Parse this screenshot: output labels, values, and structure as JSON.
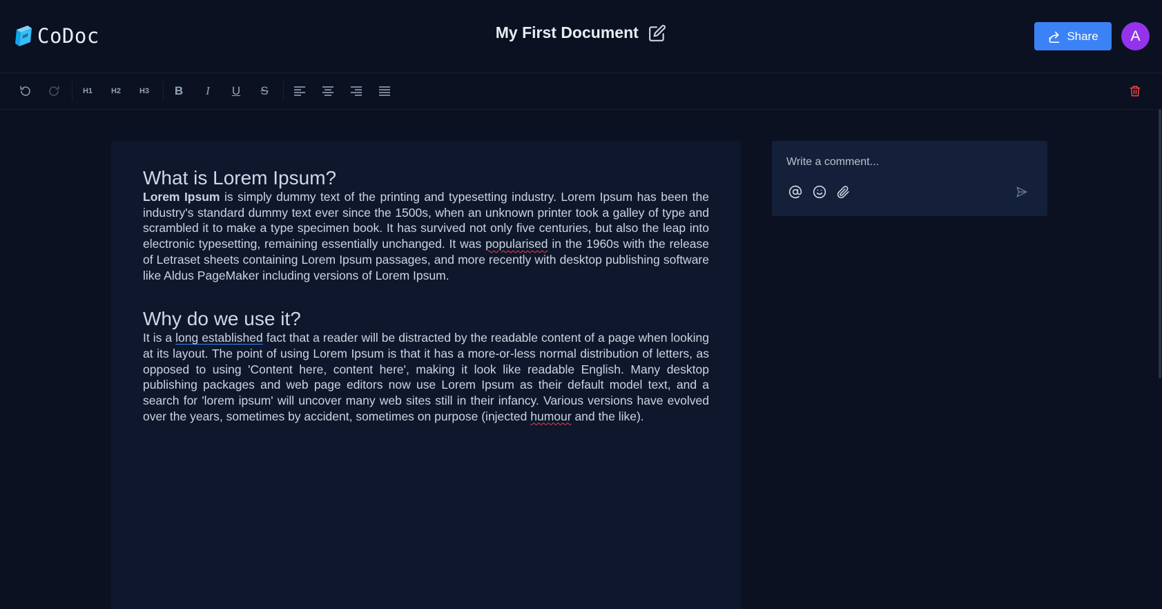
{
  "app": {
    "name": "CoDoc"
  },
  "document": {
    "title": "My First Document"
  },
  "header": {
    "share_label": "Share",
    "avatar_initial": "A"
  },
  "toolbar": {
    "undo_icon": "undo-icon",
    "redo_icon": "redo-icon",
    "h1_label": "H1",
    "h2_label": "H2",
    "h3_label": "H3",
    "bold_label": "B",
    "italic_label": "I",
    "underline_label": "U",
    "strike_label": "S",
    "delete_icon": "trash-icon",
    "delete_color": "#ef4444"
  },
  "content": {
    "section1": {
      "heading": "What is Lorem Ipsum?",
      "bold_lead": "Lorem Ipsum",
      "text_part1": " is simply dummy text of the printing and typesetting industry. Lorem Ipsum has been the industry's standard dummy text ever since the 1500s, when an unknown printer took a galley of type and scrambled it to make a type specimen book. It has survived not only five centuries, but also the leap into electronic typesetting, remaining essentially unchanged. It was ",
      "spell_word": "popularised",
      "text_part2": " in the 1960s with the release of Letraset sheets containing Lorem Ipsum passages, and more recently with desktop publishing software like Aldus PageMaker including versions of Lorem Ipsum."
    },
    "section2": {
      "heading": "Why do we use it?",
      "text_part1": "It is a ",
      "link_text": "long established",
      "text_part2": " fact that a reader will be distracted by the readable content of a page when looking at its layout. The point of using Lorem Ipsum is that it has a more-or-less normal distribution of letters, as opposed to using 'Content here, content here', making it look like readable English. Many desktop publishing packages and web page editors now use Lorem Ipsum as their default model text, and a search for 'lorem ipsum' will uncover many web sites still in their infancy. Various versions have evolved over the years, sometimes by accident, sometimes on purpose (injected ",
      "spell_word": "humour",
      "text_part3": " and the like)."
    }
  },
  "comments": {
    "placeholder": "Write a comment...",
    "icons": [
      "mention-icon",
      "emoji-icon",
      "attachment-icon",
      "send-icon"
    ]
  },
  "colors": {
    "background": "#0b1120",
    "editor_bg": "#0e172b",
    "accent": "#3b82f6",
    "avatar": "#9333ea"
  }
}
